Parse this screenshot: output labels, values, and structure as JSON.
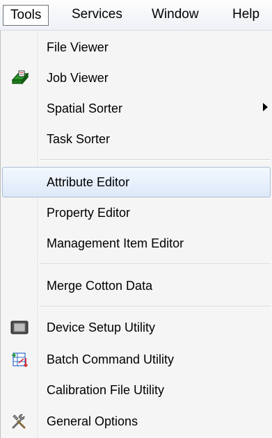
{
  "menubar": {
    "items": [
      {
        "label": "Tools",
        "active": true
      },
      {
        "label": "Services"
      },
      {
        "label": "Window"
      },
      {
        "label": "Help"
      }
    ]
  },
  "tools_menu": {
    "items": [
      {
        "label": "File Viewer"
      },
      {
        "label": "Job Viewer",
        "icon": "job-viewer-icon"
      },
      {
        "label": "Spatial Sorter",
        "submenu": true
      },
      {
        "label": "Task Sorter"
      },
      {
        "label": "Attribute Editor",
        "highlighted": true
      },
      {
        "label": "Property Editor"
      },
      {
        "label": "Management Item Editor"
      },
      {
        "label": "Merge Cotton Data"
      },
      {
        "label": "Device Setup Utility",
        "icon": "device-setup-icon"
      },
      {
        "label": "Batch Command Utility",
        "icon": "batch-command-icon"
      },
      {
        "label": "Calibration File Utility"
      },
      {
        "label": "General Options",
        "icon": "tools-icon"
      }
    ]
  },
  "colors": {
    "highlight_border": "#aebfd9",
    "menu_background": "#f5f5f5",
    "job_icon_green": "#2a9a2a",
    "batch_icon_red": "#d9262c"
  }
}
